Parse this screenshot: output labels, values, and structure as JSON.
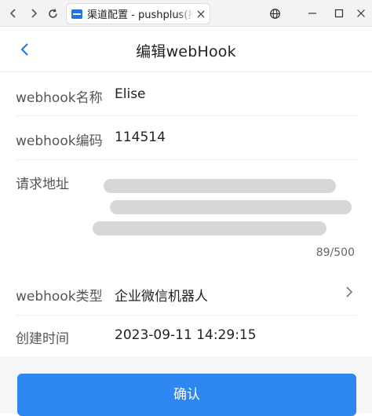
{
  "browser": {
    "tab_title": "渠道配置 - pushplus(推送加)",
    "icons": [
      "back-arrow-icon",
      "forward-arrow-icon",
      "reload-icon",
      "globe-icon",
      "minimize-icon",
      "maximize-icon",
      "close-icon"
    ]
  },
  "header": {
    "title": "编辑webHook",
    "back_icon": "chevron-left-icon"
  },
  "form": {
    "name_label": "webhook名称",
    "name_value": "Elise",
    "code_label": "webhook编码",
    "code_value": "114514",
    "url_label": "请求地址",
    "url_value_redacted": true,
    "url_counter": "89/500",
    "type_label": "webhook类型",
    "type_value": "企业微信机器人",
    "created_label": "创建时间",
    "created_value": "2023-09-11 14:29:15"
  },
  "actions": {
    "confirm_label": "确认"
  },
  "colors": {
    "accent": "#2e86f0",
    "back_icon": "#1e73e6"
  }
}
